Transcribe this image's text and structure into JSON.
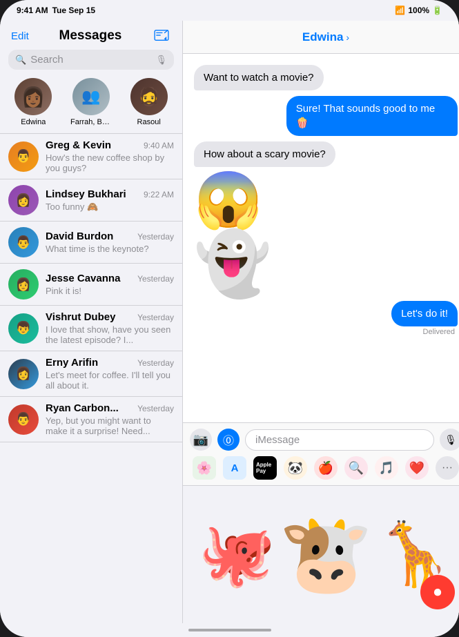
{
  "status_bar": {
    "time": "9:41 AM",
    "day": "Tue Sep 15",
    "wifi": "📶",
    "battery": "100%"
  },
  "sidebar": {
    "edit_label": "Edit",
    "title": "Messages",
    "compose_label": "✏️",
    "search_placeholder": "Search",
    "pinned": [
      {
        "name": "Edwina",
        "emoji": "👩🏾",
        "color": "pin-edwina"
      },
      {
        "name": "Farrah, Brya...",
        "emoji": "👥",
        "color": "pin-farrah"
      },
      {
        "name": "Rasoul",
        "emoji": "🧔",
        "color": "pin-rasoul"
      }
    ],
    "conversations": [
      {
        "name": "Greg & Kevin",
        "time": "9:40 AM",
        "preview": "How's the new coffee shop by you guys?",
        "color": "av-orange",
        "emoji": "👨"
      },
      {
        "name": "Lindsey Bukhari",
        "time": "9:22 AM",
        "preview": "Too funny 🙈",
        "color": "av-purple",
        "emoji": "👩"
      },
      {
        "name": "David Burdon",
        "time": "Yesterday",
        "preview": "What time is the keynote?",
        "color": "av-blue",
        "emoji": "👨"
      },
      {
        "name": "Jesse Cavanna",
        "time": "Yesterday",
        "preview": "Pink it is!",
        "color": "av-green",
        "emoji": "👩"
      },
      {
        "name": "Vishrut Dubey",
        "time": "Yesterday",
        "preview": "I love that show, have you seen the latest episode? I...",
        "color": "av-teal",
        "emoji": "👦"
      },
      {
        "name": "Erny Arifin",
        "time": "Yesterday",
        "preview": "Let's meet for coffee. I'll tell you all about it.",
        "color": "av-indigo",
        "emoji": "👩"
      },
      {
        "name": "Ryan Carbon...",
        "time": "Yesterday",
        "preview": "Yep, but you might want to make it a surprise! Need...",
        "color": "av-red",
        "emoji": "👨"
      }
    ]
  },
  "chat": {
    "contact_name": "Edwina",
    "chevron": "›",
    "messages": [
      {
        "type": "incoming",
        "text": "Want to watch a movie?",
        "emoji": false
      },
      {
        "type": "outgoing",
        "text": "Sure! That sounds good to me 🍿",
        "emoji": false
      },
      {
        "type": "incoming",
        "text": "How about a scary movie?",
        "emoji": false
      },
      {
        "type": "incoming",
        "text": "😱",
        "is_sticker": true
      },
      {
        "type": "incoming",
        "text": "👻",
        "is_sticker": true
      },
      {
        "type": "outgoing",
        "text": "Let's do it!",
        "emoji": false,
        "delivered": true
      }
    ],
    "delivered_label": "Delivered",
    "input_placeholder": "iMessage",
    "apps": [
      {
        "name": "photos",
        "emoji": "🌸",
        "bg": "#e8f4e8"
      },
      {
        "name": "appstore",
        "emoji": "🅐",
        "bg": "#ddeeff"
      },
      {
        "name": "applepay",
        "text": "Apple Pay",
        "bg": "#000",
        "color": "#fff"
      },
      {
        "name": "memoji",
        "emoji": "🐼",
        "bg": "#fff3e0"
      },
      {
        "name": "emoji",
        "emoji": "🍎",
        "bg": "#ffe0e0"
      },
      {
        "name": "search",
        "emoji": "🔍",
        "bg": "#fce4ec"
      },
      {
        "name": "music",
        "emoji": "🎵",
        "bg": "#fff0f0"
      },
      {
        "name": "heart",
        "emoji": "❤️",
        "bg": "#fce4ec"
      },
      {
        "name": "more",
        "text": "···",
        "bg": "#e5e5ea"
      }
    ]
  },
  "memoji_panel": {
    "items": [
      "🐙",
      "🐄",
      "🦒"
    ],
    "record_label": "⏺"
  }
}
